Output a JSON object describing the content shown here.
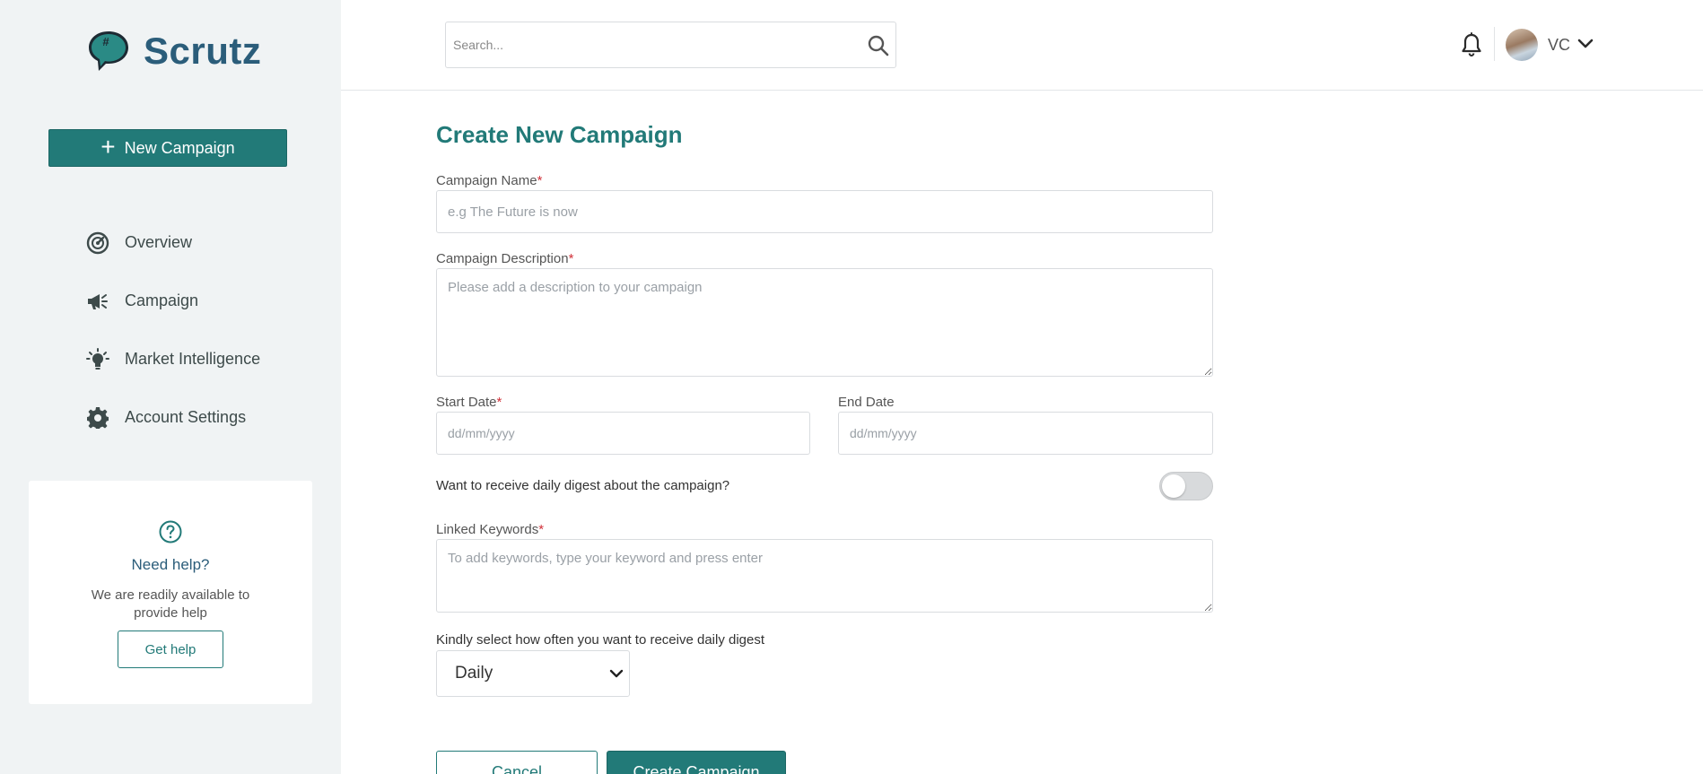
{
  "app": {
    "name": "Scrutz",
    "colors": {
      "primary": "#227a78",
      "brand_text": "#2b5d7a",
      "sidebar_bg": "#f0f3f4",
      "required": "#d1323a"
    }
  },
  "sidebar": {
    "new_campaign_label": "New Campaign",
    "items": [
      {
        "label": "Overview",
        "icon": "speedometer-icon"
      },
      {
        "label": "Campaign",
        "icon": "megaphone-icon"
      },
      {
        "label": "Market Intelligence",
        "icon": "lightbulb-icon"
      },
      {
        "label": "Account Settings",
        "icon": "gear-icon"
      }
    ],
    "help": {
      "title": "Need help?",
      "text": "We are readily available to provide help",
      "button_label": "Get help"
    }
  },
  "header": {
    "search_placeholder": "Search...",
    "user_initials": "VC"
  },
  "form": {
    "title": "Create New Campaign",
    "campaign_name": {
      "label": "Campaign Name",
      "required_mark": "*",
      "placeholder": "e.g The Future is now",
      "value": ""
    },
    "campaign_description": {
      "label": "Campaign Description",
      "required_mark": "*",
      "placeholder": "Please add a description to your campaign",
      "value": ""
    },
    "start_date": {
      "label": "Start Date",
      "required_mark": "*",
      "placeholder": "dd/mm/yyyy",
      "value": ""
    },
    "end_date": {
      "label": "End Date",
      "placeholder": "dd/mm/yyyy",
      "value": ""
    },
    "daily_digest": {
      "label": "Want to receive daily digest about the campaign?",
      "enabled": false
    },
    "linked_keywords": {
      "label": "Linked Keywords",
      "required_mark": "*",
      "placeholder": "To add keywords, type your keyword and press enter",
      "value": ""
    },
    "frequency": {
      "label": "Kindly select how often you want to receive daily digest",
      "selected": "Daily"
    },
    "cancel_label": "Cancel",
    "create_label": "Create Campaign"
  }
}
